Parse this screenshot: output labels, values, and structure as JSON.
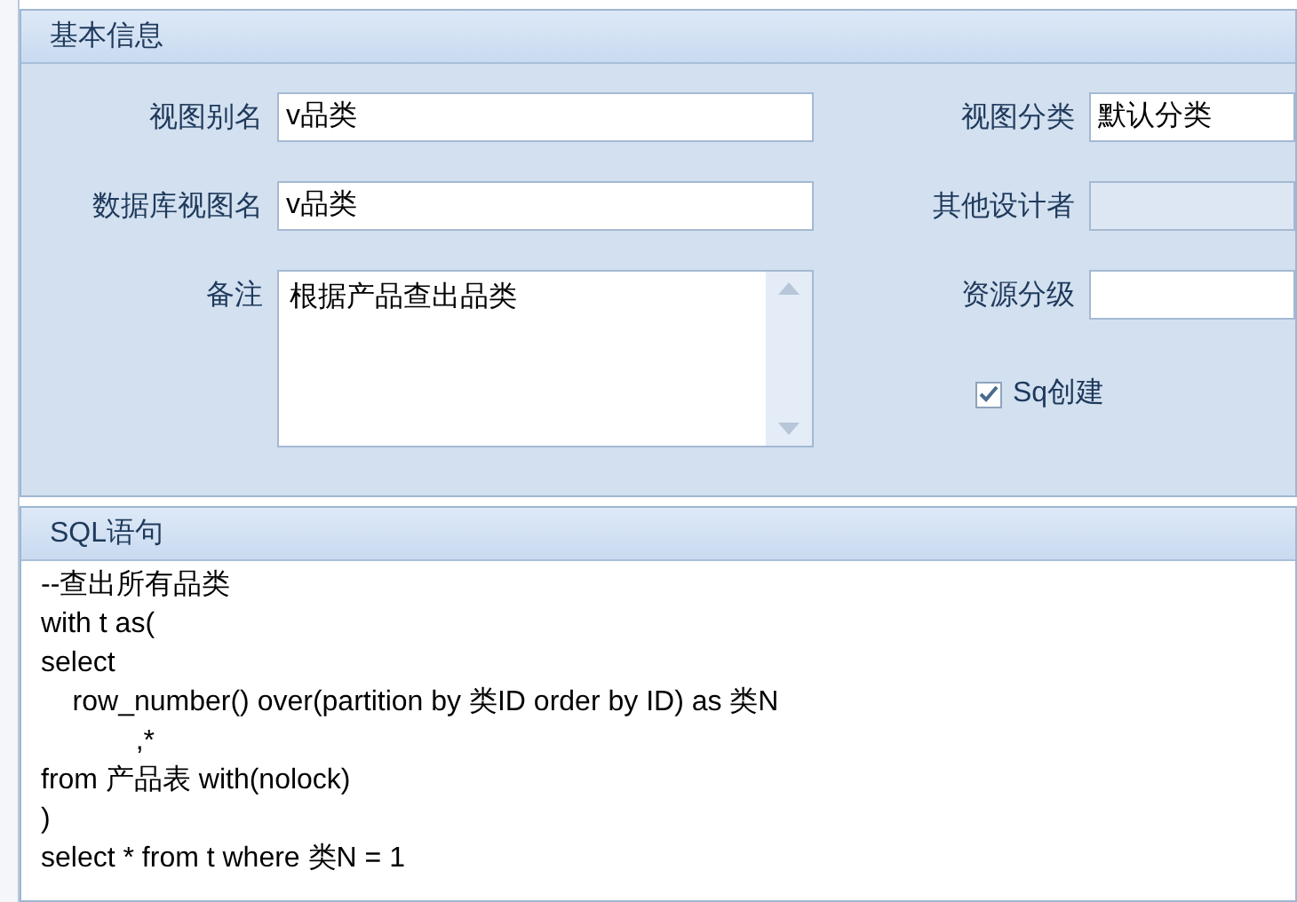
{
  "basic_info": {
    "title": "基本信息",
    "left_fields": [
      {
        "kind": "text",
        "label": "视图别名",
        "value": "v品类"
      },
      {
        "kind": "text",
        "label": "数据库视图名",
        "value": "v品类"
      },
      {
        "kind": "memo",
        "label": "备注",
        "value": "根据产品查出品类"
      }
    ],
    "right_fields": [
      {
        "label": "视图分类",
        "value": "默认分类",
        "disabled": false
      },
      {
        "label": "其他设计者",
        "disabled": true
      },
      {
        "label": "资源分级",
        "disabled": false
      }
    ],
    "checkbox": {
      "label": "Sq创建",
      "checked": true
    }
  },
  "sql": {
    "title": "SQL语句",
    "lines": [
      "--查出所有品类",
      "with t as(",
      "select",
      "    row_number() over(partition by 类ID order by ID) as 类N",
      "            ,*",
      "from 产品表 with(nolock)",
      ")",
      "select * from t where 类N = 1"
    ]
  }
}
